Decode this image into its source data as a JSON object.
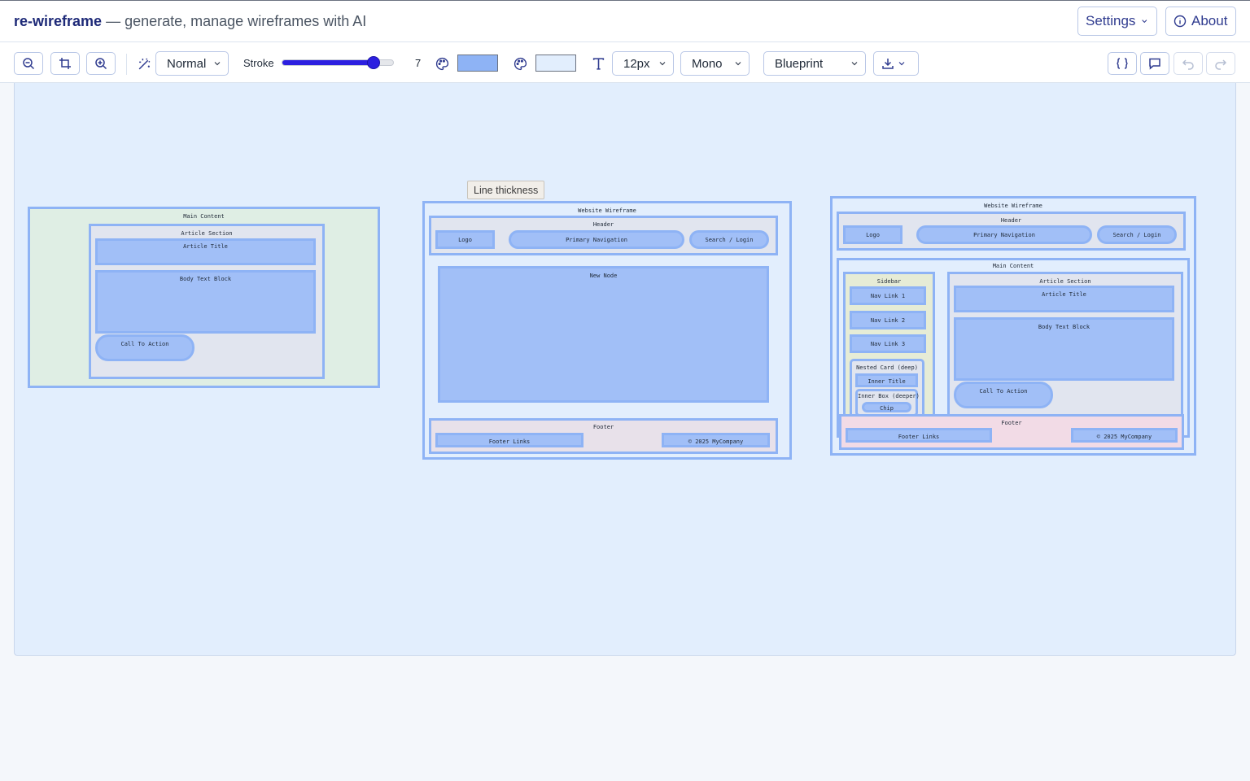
{
  "app": {
    "name": "re-wireframe",
    "tagline": "— generate, manage wireframes with AI",
    "settings_label": "Settings",
    "about_label": "About"
  },
  "toolbar": {
    "style_select": "Normal",
    "stroke_label": "Stroke",
    "stroke_value": "7",
    "stroke_fraction": 0.82,
    "stroke_color": "#8eb3f5",
    "fill_color": "#e2eefd",
    "font_size": "12px",
    "font_family": "Mono",
    "theme": "Blueprint",
    "tooltip": "Line thickness"
  },
  "canvas": {
    "wf1": {
      "main": "Main Content",
      "article_section": "Article Section",
      "article_title": "Article Title",
      "body_text": "Body Text Block",
      "cta": "Call To Action"
    },
    "wf2": {
      "title": "Website Wireframe",
      "header": "Header",
      "logo": "Logo",
      "nav": "Primary Navigation",
      "search": "Search / Login",
      "new_node": "New Node",
      "footer": "Footer",
      "footer_links": "Footer Links",
      "copyright": "© 2025 MyCompany"
    },
    "wf3": {
      "title": "Website Wireframe",
      "header": "Header",
      "logo": "Logo",
      "nav": "Primary Navigation",
      "search": "Search / Login",
      "main": "Main Content",
      "sidebar": "Sidebar",
      "nav1": "Nav Link 1",
      "nav2": "Nav Link 2",
      "nav3": "Nav Link 3",
      "nested": "Nested Card (deep)",
      "inner_title": "Inner Title",
      "inner_box": "Inner Box (deeper)",
      "chip": "Chip",
      "article_section": "Article Section",
      "article_title": "Article Title",
      "body_text": "Body Text Block",
      "cta": "Call To Action",
      "footer": "Footer",
      "footer_links": "Footer Links",
      "copyright": "© 2025 MyCompany"
    }
  }
}
